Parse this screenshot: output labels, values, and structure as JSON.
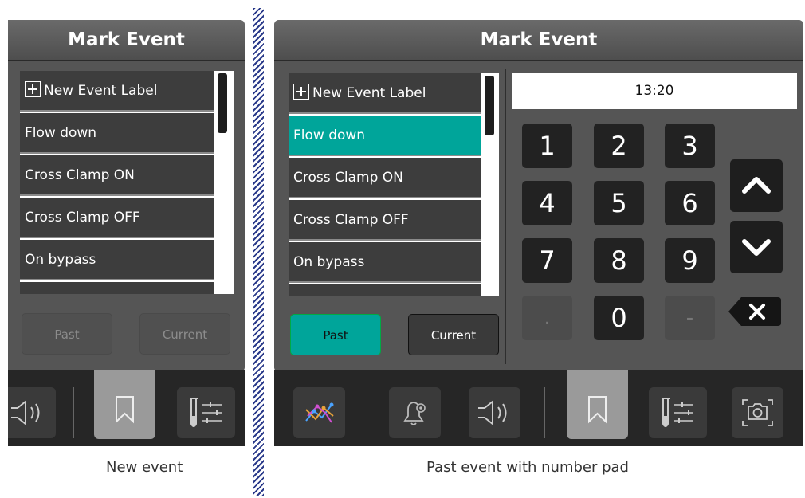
{
  "screens": [
    {
      "title": "Mark Event",
      "new_label": "New Event Label",
      "items": [
        "Flow down",
        "Cross Clamp ON",
        "Cross Clamp OFF",
        "On bypass"
      ],
      "past_label": "Past",
      "current_label": "Current",
      "caption": "New event"
    },
    {
      "title": "Mark Event",
      "new_label": "New Event Label",
      "items": [
        "Flow down",
        "Cross Clamp ON",
        "Cross Clamp OFF",
        "On bypass"
      ],
      "selected_item": "Flow down",
      "past_label": "Past",
      "current_label": "Current",
      "time_value": "13:20",
      "keys": [
        "1",
        "2",
        "3",
        "4",
        "5",
        "6",
        "7",
        "8",
        "9",
        ".",
        "0",
        "-"
      ],
      "caption": "Past event with number pad"
    }
  ],
  "colors": {
    "accent": "#00a59a",
    "panel": "#555555",
    "list_row": "#3d3d3d",
    "toolbar": "#262626",
    "divider_stripes": "#2a3a8a"
  },
  "icons": [
    "speaker-icon",
    "bookmark-icon",
    "test-tube-settings-icon",
    "trend-graph-icon",
    "alarm-settings-icon",
    "camera-icon",
    "chevron-up-icon",
    "chevron-down-icon",
    "backspace-icon"
  ]
}
